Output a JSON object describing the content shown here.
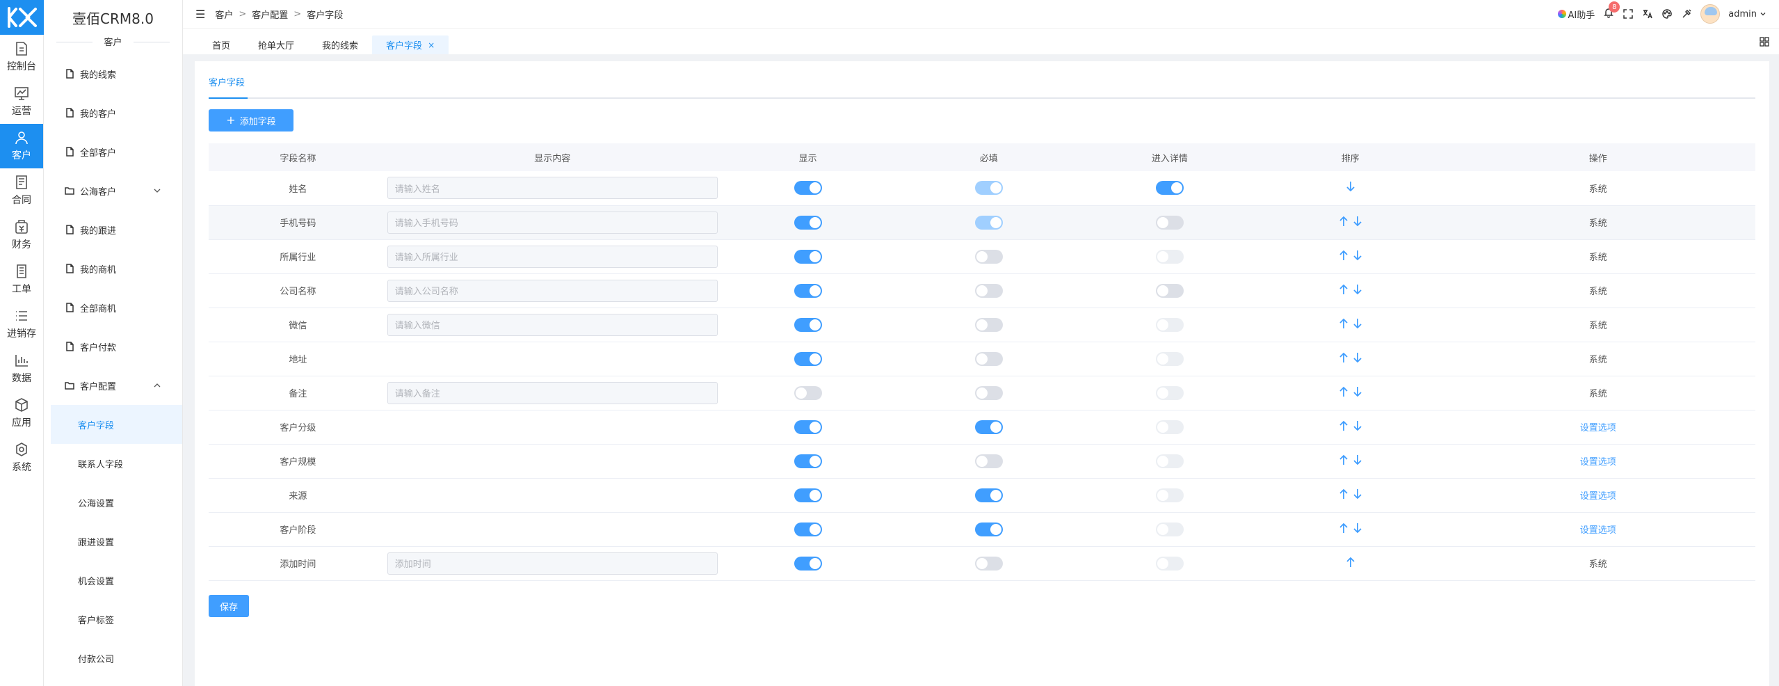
{
  "app": {
    "title": "壹佰CRM8.0",
    "section": "客户"
  },
  "rail": [
    {
      "label": "控制台",
      "icon": "dashboard-icon"
    },
    {
      "label": "运营",
      "icon": "chart-line-icon"
    },
    {
      "label": "客户",
      "icon": "user-icon"
    },
    {
      "label": "合同",
      "icon": "contract-icon"
    },
    {
      "label": "财务",
      "icon": "finance-icon"
    },
    {
      "label": "工单",
      "icon": "ticket-icon"
    },
    {
      "label": "进销存",
      "icon": "list-icon"
    },
    {
      "label": "数据",
      "icon": "bar-chart-icon"
    },
    {
      "label": "应用",
      "icon": "box-icon"
    },
    {
      "label": "系统",
      "icon": "system-icon"
    }
  ],
  "sidebar": {
    "items": [
      {
        "label": "我的线索"
      },
      {
        "label": "我的客户"
      },
      {
        "label": "全部客户"
      },
      {
        "label": "公海客户"
      },
      {
        "label": "我的跟进"
      },
      {
        "label": "我的商机"
      },
      {
        "label": "全部商机"
      },
      {
        "label": "客户付款"
      },
      {
        "label": "客户配置"
      }
    ],
    "children": [
      {
        "label": "客户字段"
      },
      {
        "label": "联系人字段"
      },
      {
        "label": "公海设置"
      },
      {
        "label": "跟进设置"
      },
      {
        "label": "机会设置"
      },
      {
        "label": "客户标签"
      },
      {
        "label": "付款公司"
      }
    ]
  },
  "header": {
    "breadcrumb": [
      "客户",
      "客户配置",
      "客户字段"
    ],
    "ai_label": "AI助手",
    "notification_count": "8",
    "user": "admin"
  },
  "tabs": [
    {
      "label": "首页"
    },
    {
      "label": "抢单大厅"
    },
    {
      "label": "我的线索"
    },
    {
      "label": "客户字段",
      "close": "×"
    }
  ],
  "page": {
    "inner_tab": "客户字段",
    "add_button": "添加字段",
    "add_plus": "+",
    "save_button": "保存"
  },
  "table": {
    "headers": [
      "字段名称",
      "显示内容",
      "显示",
      "必填",
      "进入详情",
      "排序",
      "操作"
    ],
    "rows": [
      {
        "name": "姓名",
        "placeholder": "请输入姓名",
        "show": "on",
        "required": "on-disabled",
        "detail": "on",
        "sort": "down",
        "op": "系统",
        "op_link": false
      },
      {
        "name": "手机号码",
        "placeholder": "请输入手机号码",
        "show": "on",
        "required": "on-disabled",
        "detail": "off",
        "sort": "both",
        "op": "系统",
        "op_link": false
      },
      {
        "name": "所属行业",
        "placeholder": "请输入所属行业",
        "show": "on",
        "required": "off",
        "detail": "off-disabled",
        "sort": "both",
        "op": "系统",
        "op_link": false
      },
      {
        "name": "公司名称",
        "placeholder": "请输入公司名称",
        "show": "on",
        "required": "off",
        "detail": "off",
        "sort": "both",
        "op": "系统",
        "op_link": false
      },
      {
        "name": "微信",
        "placeholder": "请输入微信",
        "show": "on",
        "required": "off",
        "detail": "off-disabled",
        "sort": "both",
        "op": "系统",
        "op_link": false
      },
      {
        "name": "地址",
        "placeholder": "",
        "show": "on",
        "required": "off",
        "detail": "off-disabled",
        "sort": "both",
        "op": "系统",
        "op_link": false
      },
      {
        "name": "备注",
        "placeholder": "请输入备注",
        "show": "off",
        "required": "off",
        "detail": "off-disabled",
        "sort": "both",
        "op": "系统",
        "op_link": false
      },
      {
        "name": "客户分级",
        "placeholder": "",
        "show": "on",
        "required": "on",
        "detail": "off-disabled",
        "sort": "both",
        "op": "设置选项",
        "op_link": true
      },
      {
        "name": "客户规模",
        "placeholder": "",
        "show": "on",
        "required": "off",
        "detail": "off-disabled",
        "sort": "both",
        "op": "设置选项",
        "op_link": true
      },
      {
        "name": "来源",
        "placeholder": "",
        "show": "on",
        "required": "on",
        "detail": "off-disabled",
        "sort": "both",
        "op": "设置选项",
        "op_link": true
      },
      {
        "name": "客户阶段",
        "placeholder": "",
        "show": "on",
        "required": "on",
        "detail": "off-disabled",
        "sort": "both",
        "op": "设置选项",
        "op_link": true
      },
      {
        "name": "添加时间",
        "placeholder": "添加时间",
        "show": "on",
        "required": "off",
        "detail": "off-disabled",
        "sort": "up",
        "op": "系统",
        "op_link": false
      }
    ]
  },
  "colors": {
    "primary": "#1d8ff0",
    "button": "#409eff",
    "active_bg": "#ecf5ff"
  }
}
